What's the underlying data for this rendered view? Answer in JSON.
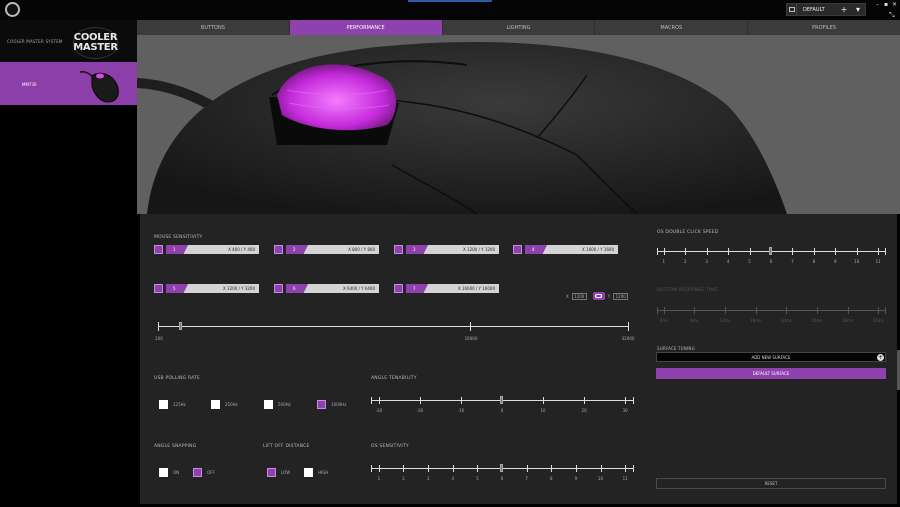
{
  "topbar": {
    "profile": "DEFAULT",
    "add": "+",
    "dropdown": "▾",
    "min": "–",
    "max": "▪",
    "close": "✕",
    "resize": "⤡"
  },
  "sidebar": {
    "brand_text": "COOLER MASTER SYSTEM",
    "logo_line1": "COOLER",
    "logo_line2": "MASTER",
    "device": "MM730"
  },
  "tabs": [
    {
      "label": "BUTTONS"
    },
    {
      "label": "PERFORMANCE"
    },
    {
      "label": "LIGHTING"
    },
    {
      "label": "MACROS"
    },
    {
      "label": "PROFILES"
    }
  ],
  "sensitivity": {
    "title": "MOUSE SENSITIVITY",
    "levels": [
      {
        "n": "1",
        "value": "X 400 / Y 400"
      },
      {
        "n": "2",
        "value": "X 800 / Y 800"
      },
      {
        "n": "3",
        "value": "X 1200 / Y 1200"
      },
      {
        "n": "4",
        "value": "X 1600 / Y 1600"
      },
      {
        "n": "5",
        "value": "X 3200 / Y 3200"
      },
      {
        "n": "6",
        "value": "X 6400 / Y 6400"
      },
      {
        "n": "7",
        "value": "X 16000 / Y 16000"
      }
    ],
    "x_label": "X",
    "x_value": "1200",
    "y_label": "Y",
    "y_value": "1200",
    "scale": [
      "200",
      "16000",
      "32000"
    ]
  },
  "polling": {
    "title": "USB POLLING RATE",
    "options": [
      {
        "label": "125Hz",
        "on": false
      },
      {
        "label": "250Hz",
        "on": false
      },
      {
        "label": "500Hz",
        "on": false
      },
      {
        "label": "1000Hz",
        "on": true
      }
    ]
  },
  "angle_tunability": {
    "title": "ANGLE TENABILITY",
    "labels": [
      "-30",
      "-20",
      "-10",
      "0",
      "10",
      "20",
      "30"
    ],
    "value": 0
  },
  "angle_snapping": {
    "title": "ANGLE SNAPPING",
    "options": [
      {
        "label": "ON",
        "on": false
      },
      {
        "label": "OFF",
        "on": true
      }
    ]
  },
  "lift_off": {
    "title": "LIFT OFF DISTANCE",
    "options": [
      {
        "label": "LOW",
        "on": true
      },
      {
        "label": "HIGH",
        "on": false
      }
    ]
  },
  "os_sensitivity": {
    "title": "OS SENSITIVITY",
    "labels": [
      "1",
      "2",
      "3",
      "4",
      "5",
      "6",
      "7",
      "8",
      "9",
      "10",
      "11"
    ],
    "value": 6
  },
  "double_click": {
    "title": "OS DOUBLE CLICK SPEED",
    "labels": [
      "1",
      "2",
      "3",
      "4",
      "5",
      "6",
      "7",
      "8",
      "9",
      "10",
      "11"
    ],
    "value": 6
  },
  "button_response": {
    "title": "BUTTON RESPONSE TIME",
    "labels": [
      "4ms",
      "8ms",
      "12ms",
      "16ms",
      "20ms",
      "24ms",
      "28ms",
      "32ms"
    ]
  },
  "surface": {
    "title": "SURFACE TUNING",
    "add": "ADD NEW SURFACE",
    "add_icon": "+",
    "default": "DEFAULT SURFACE"
  },
  "reset": "RESET",
  "colors": {
    "accent": "#8f42ad",
    "panel": "#232323"
  }
}
